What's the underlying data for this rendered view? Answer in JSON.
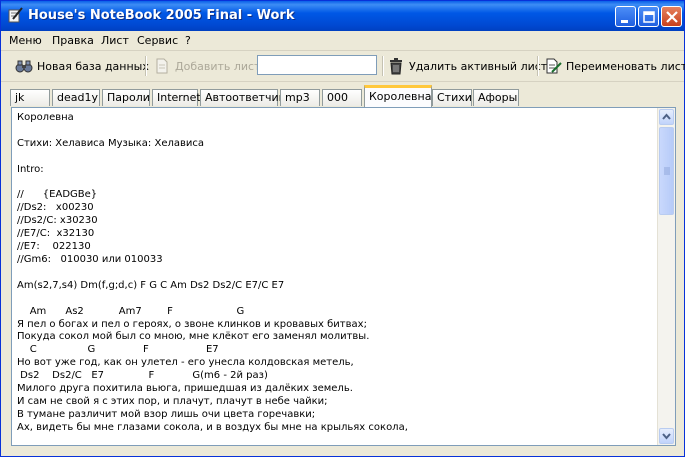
{
  "window": {
    "title": "House's NoteBook 2005 Final - Work"
  },
  "menu": {
    "items": [
      "Меню",
      "Правка",
      "Лист",
      "Сервис",
      "?"
    ]
  },
  "toolbar": {
    "new_db": "Новая база данных",
    "add_sheet": "Добавить лист",
    "sheet_name_value": "",
    "delete_sheet": "Удалить активный лист",
    "rename_sheet": "Переименовать лист"
  },
  "tabs": [
    "jk",
    "dead1y",
    "Пароли",
    "Internet",
    "Автоответчик",
    "mp3",
    "000",
    "Королевна",
    "Стихи",
    "Афоры"
  ],
  "active_tab": "Королевна",
  "document": {
    "lines": [
      "Королевна",
      "",
      "Стихи: Хелависа Музыка: Хелависа",
      "",
      "Intro:",
      "",
      "//      {EADGBe}",
      "//Ds2:   x00230",
      "//Ds2/C: x30230",
      "//E7/C:  x32130",
      "//E7:    022130",
      "//Gm6:   010030 или 010033",
      "",
      "Am(s2,7,s4) Dm(f,g;d,c) F G C Am Ds2 Ds2/C E7/C E7",
      "",
      "    Am      As2           Am7        F                    G",
      "Я пел о богах и пел о героях, о звоне клинков и кровавых битвах;",
      "Покуда сокол мой был со мною, мне клёкот его заменял молитвы.",
      "    C                G               F                  E7",
      "Но вот уже год, как он улетел - его унесла колдовская метель,",
      " Ds2    Ds2/C   E7              F            G(m6 - 2й раз)",
      "Милого друга похитила вьюга, пришедшая из далёких земель.",
      "И сам не свой я с этих пор, и плачут, плачут в небе чайки;",
      "В тумане различит мой взор лишь очи цвета горечавки;",
      "Ах, видеть бы мне глазами сокола, и в воздух бы мне на крыльях сокола,"
    ]
  },
  "icons": {
    "app": "pen-notebook-icon",
    "new_db": "binoculars-icon",
    "add_sheet": "page-icon",
    "delete_sheet": "trash-icon",
    "rename_sheet": "edit-page-icon"
  }
}
